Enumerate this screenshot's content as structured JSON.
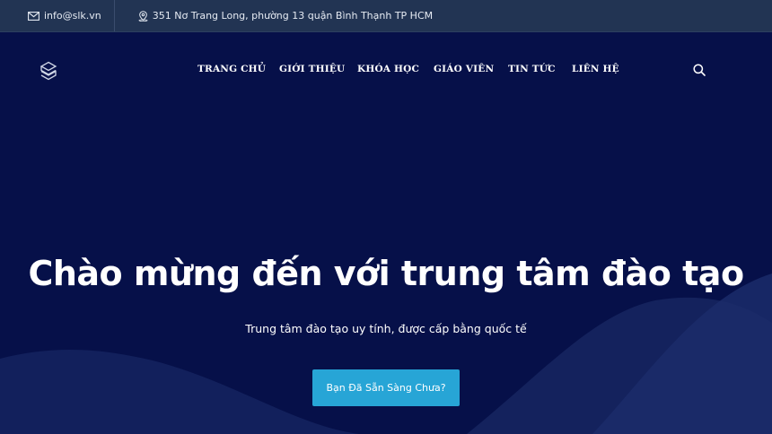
{
  "topbar": {
    "email": "info@slk.vn",
    "email_icon": "envelope-icon",
    "address": "351 Nơ Trang Long, phường 13 quận Bình Thạnh TP HCM",
    "address_icon": "map-pin-icon"
  },
  "nav": {
    "logo_icon": "s-logo-icon",
    "items": [
      {
        "label": "TRANG CHỦ"
      },
      {
        "label": "GIỚI THIỆU"
      },
      {
        "label": "KHÓA HỌC"
      },
      {
        "label": "GIÁO VIÊN"
      },
      {
        "label": "TIN TỨC"
      },
      {
        "label": "LIÊN HỆ"
      }
    ],
    "search_icon": "search-icon"
  },
  "hero": {
    "title": "Chào mừng đến với trung tâm đào tạo",
    "subtitle": "Trung tâm đào tạo uy tính, được cấp bằng quốc tế",
    "cta_label": "Bạn Đã Sẵn Sàng Chưa?"
  },
  "colors": {
    "background": "#061049",
    "topbar": "#223453",
    "accent": "#27a5d6",
    "wave": "#1a2a68"
  }
}
